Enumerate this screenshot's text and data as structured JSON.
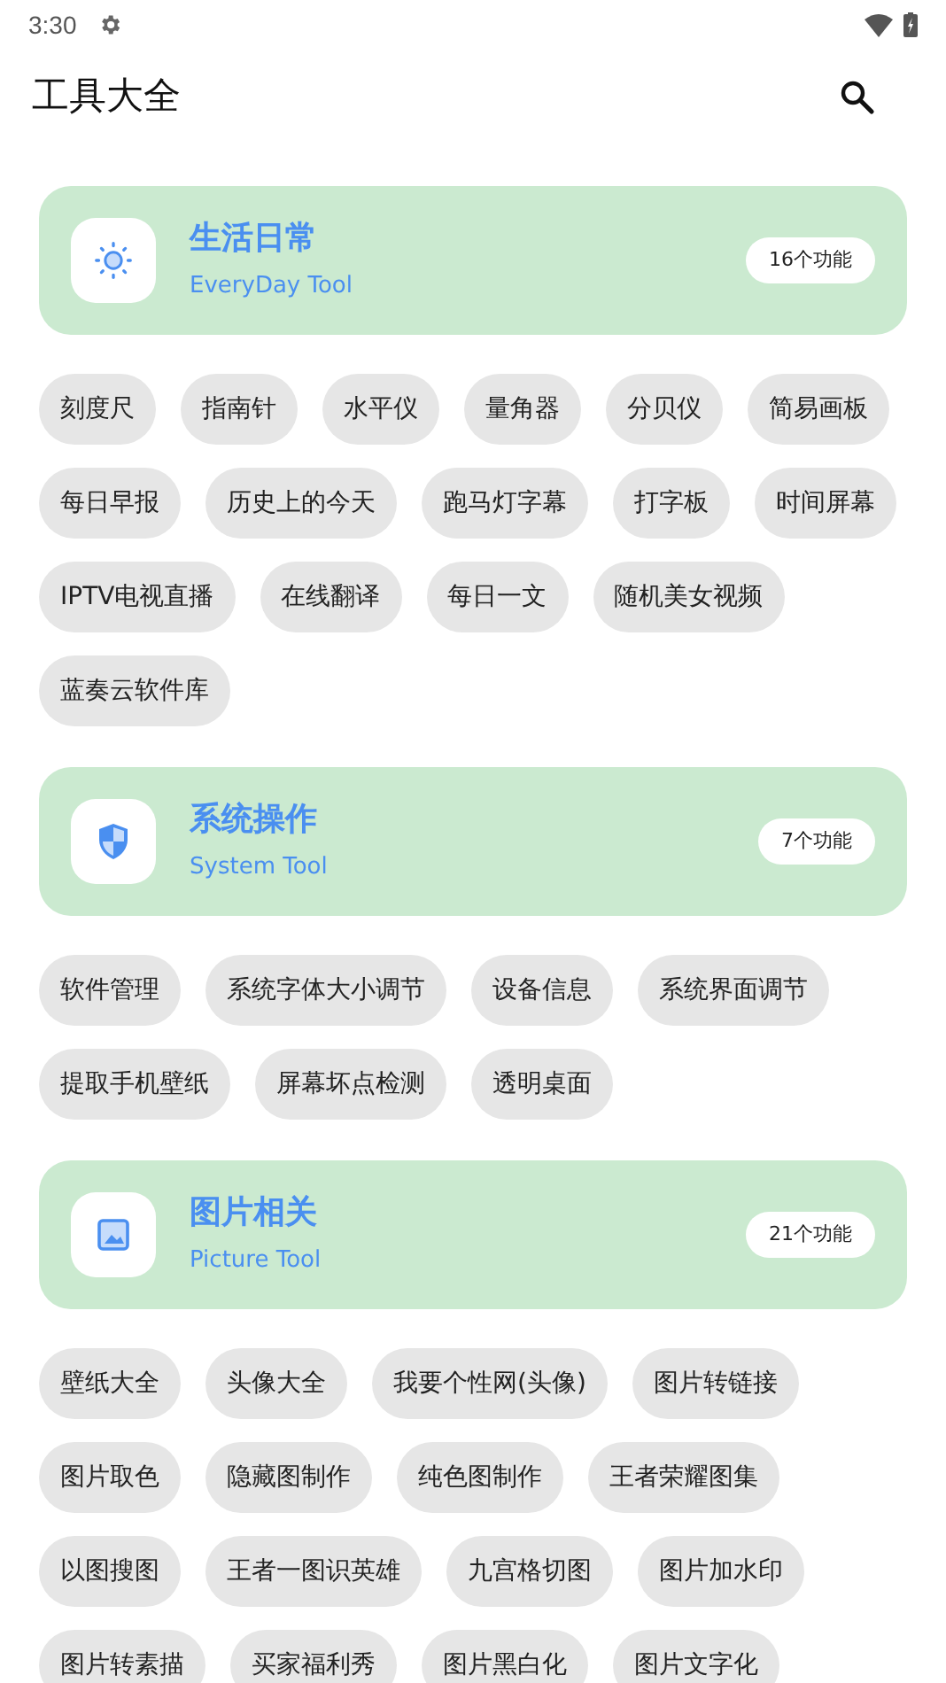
{
  "status_bar": {
    "time": "3:30"
  },
  "app_bar": {
    "title": "工具大全"
  },
  "sections": [
    {
      "kind": "daily",
      "title": "生活日常",
      "subtitle": "EveryDay Tool",
      "count": "16个功能",
      "tools": [
        "刻度尺",
        "指南针",
        "水平仪",
        "量角器",
        "分贝仪",
        "简易画板",
        "每日早报",
        "历史上的今天",
        "跑马灯字幕",
        "打字板",
        "时间屏幕",
        "IPTV电视直播",
        "在线翻译",
        "每日一文",
        "随机美女视频",
        "蓝奏云软件库"
      ]
    },
    {
      "kind": "system",
      "title": "系统操作",
      "subtitle": "System Tool",
      "count": "7个功能",
      "tools": [
        "软件管理",
        "系统字体大小调节",
        "设备信息",
        "系统界面调节",
        "提取手机壁纸",
        "屏幕坏点检测",
        "透明桌面"
      ]
    },
    {
      "kind": "picture",
      "title": "图片相关",
      "subtitle": "Picture Tool",
      "count": "21个功能",
      "tools": [
        "壁纸大全",
        "头像大全",
        "我要个性网(头像)",
        "图片转链接",
        "图片取色",
        "隐藏图制作",
        "纯色图制作",
        "王者荣耀图集",
        "以图搜图",
        "王者一图识英雄",
        "九宫格切图",
        "图片加水印",
        "图片转素描",
        "买家福利秀",
        "图片黑白化",
        "图片文字化"
      ]
    }
  ]
}
